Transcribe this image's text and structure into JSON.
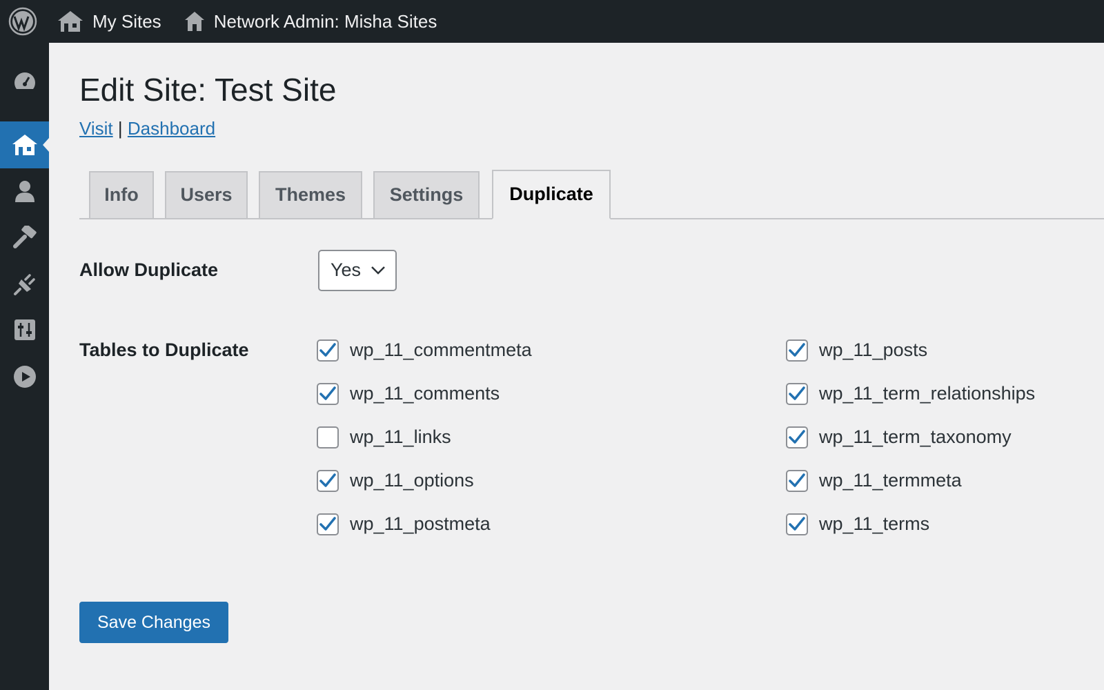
{
  "admin_bar": {
    "my_sites": "My Sites",
    "network_admin": "Network Admin: Misha Sites"
  },
  "sidebar": {
    "items": [
      {
        "icon": "dashboard-icon"
      },
      {
        "icon": "sites-icon",
        "current": true
      },
      {
        "icon": "users-icon"
      },
      {
        "icon": "themes-icon"
      },
      {
        "icon": "plugins-icon"
      },
      {
        "icon": "settings-icon"
      },
      {
        "icon": "play-icon"
      }
    ],
    "accent": "#2271b1"
  },
  "page": {
    "title": "Edit Site: Test Site",
    "visit_link": "Visit",
    "separator": "|",
    "dashboard_link": "Dashboard"
  },
  "tabs": [
    {
      "label": "Info"
    },
    {
      "label": "Users"
    },
    {
      "label": "Themes"
    },
    {
      "label": "Settings"
    },
    {
      "label": "Duplicate",
      "active": true
    }
  ],
  "form": {
    "allow_duplicate_label": "Allow Duplicate",
    "allow_duplicate_value": "Yes",
    "tables_label": "Tables to Duplicate",
    "tables": [
      {
        "name": "wp_11_commentmeta",
        "checked": true
      },
      {
        "name": "wp_11_comments",
        "checked": true
      },
      {
        "name": "wp_11_links",
        "checked": false
      },
      {
        "name": "wp_11_options",
        "checked": true
      },
      {
        "name": "wp_11_postmeta",
        "checked": true
      },
      {
        "name": "wp_11_posts",
        "checked": true
      },
      {
        "name": "wp_11_term_relationships",
        "checked": true
      },
      {
        "name": "wp_11_term_taxonomy",
        "checked": true
      },
      {
        "name": "wp_11_termmeta",
        "checked": true
      },
      {
        "name": "wp_11_terms",
        "checked": true
      }
    ],
    "save_label": "Save Changes"
  }
}
